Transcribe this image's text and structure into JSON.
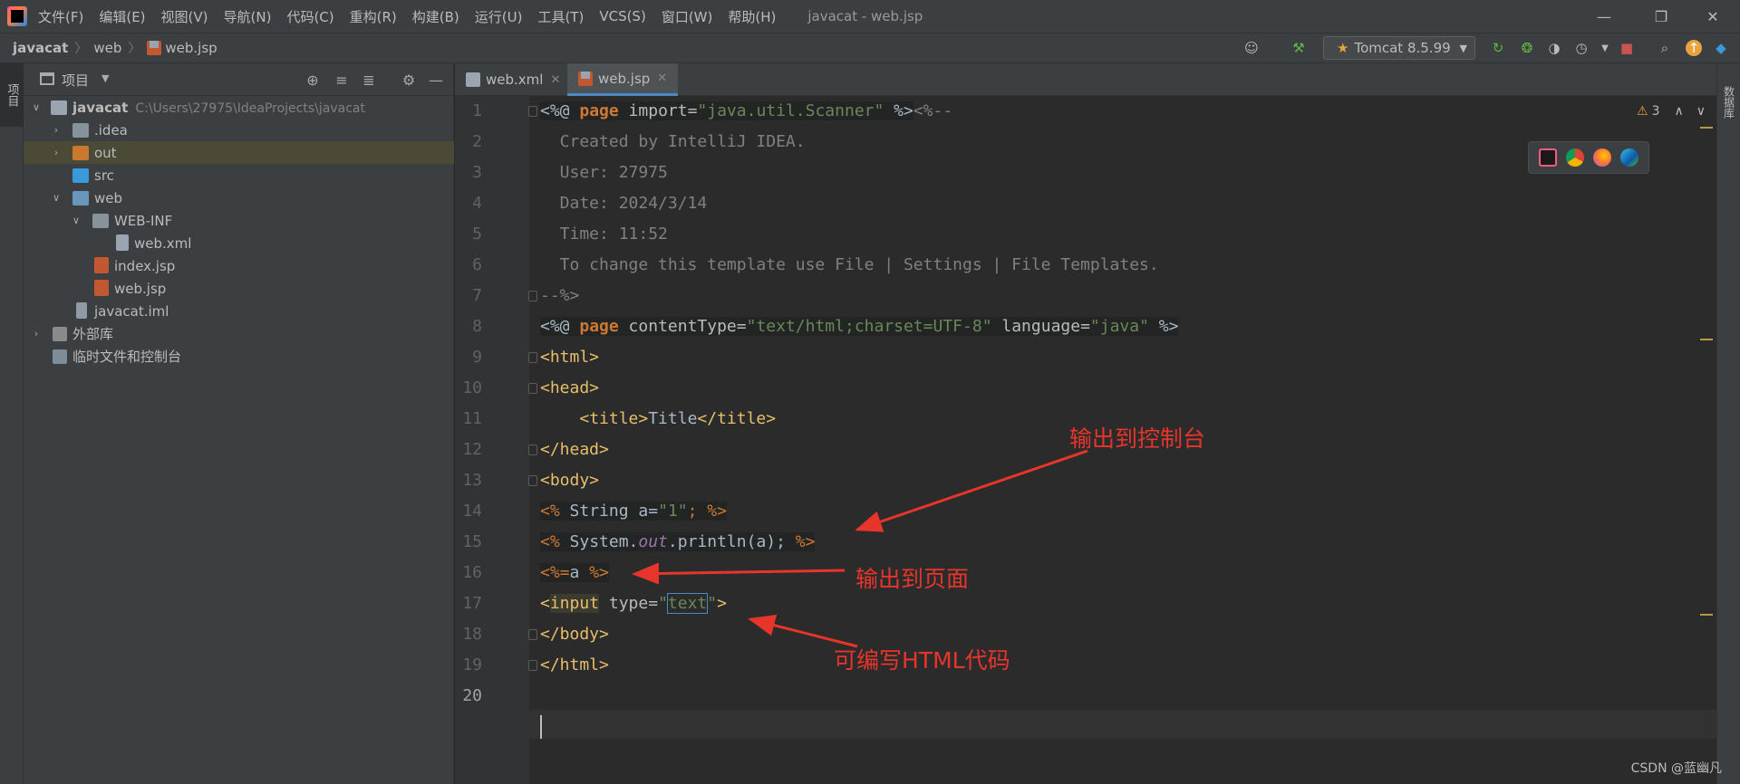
{
  "menu": {
    "items": [
      "文件(F)",
      "编辑(E)",
      "视图(V)",
      "导航(N)",
      "代码(C)",
      "重构(R)",
      "构建(B)",
      "运行(U)",
      "工具(T)",
      "VCS(S)",
      "窗口(W)",
      "帮助(H)"
    ],
    "window_title": "javacat - web.jsp"
  },
  "nav": {
    "crumb_project": "javacat",
    "crumb_folder": "web",
    "crumb_file": "web.jsp",
    "run_config": "Tomcat 8.5.99"
  },
  "side_tabs": {
    "left": "项目",
    "right": "数据库"
  },
  "project": {
    "header": "项目",
    "tree": {
      "root": "javacat",
      "root_path": "C:\\Users\\27975\\IdeaProjects\\javacat",
      "idea": ".idea",
      "out": "out",
      "src": "src",
      "web": "web",
      "webinf": "WEB-INF",
      "webxml": "web.xml",
      "indexjsp": "index.jsp",
      "webjsp": "web.jsp",
      "iml": "javacat.iml",
      "libs": "外部库",
      "scratch": "临时文件和控制台"
    }
  },
  "tabs": [
    "web.xml",
    "web.jsp"
  ],
  "editor": {
    "warnings": "3",
    "line_numbers": [
      "1",
      "2",
      "3",
      "4",
      "5",
      "6",
      "7",
      "8",
      "9",
      "10",
      "11",
      "12",
      "13",
      "14",
      "15",
      "16",
      "17",
      "18",
      "19",
      "20"
    ],
    "lines": {
      "l1_a": "<%@",
      "l1_b": "page",
      "l1_c": " import=",
      "l1_d": "\"java.util.Scanner\"",
      "l1_e": " %>",
      "l1_f": "<%--",
      "l2": "  Created by IntelliJ IDEA.",
      "l3": "  User: 27975",
      "l4": "  Date: 2024/3/14",
      "l5": "  Time: 11:52",
      "l6": "  To change this template use File | Settings | File Templates.",
      "l7": "--%>",
      "l8_a": "<%@",
      "l8_b": "page",
      "l8_c": " contentType=",
      "l8_d": "\"text/html;charset=UTF-8\"",
      "l8_e": " language=",
      "l8_f": "\"java\"",
      "l8_g": " %>",
      "l9": "<html>",
      "l10": "<head>",
      "l11_a": "<title>",
      "l11_b": "Title",
      "l11_c": "</title>",
      "l12": "</head>",
      "l13": "<body>",
      "l14_a": "<%",
      "l14_b": " String a=",
      "l14_c": "\"1\"",
      "l14_d": "; ",
      "l14_e": "%>",
      "l15_a": "<%",
      "l15_b": " System.",
      "l15_c": "out",
      "l15_d": ".println(a); ",
      "l15_e": "%>",
      "l16_a": "<%=",
      "l16_b": "a ",
      "l16_c": "%>",
      "l17_a": "<",
      "l17_b": "input",
      "l17_c": " type=",
      "l17_d": "\"",
      "l17_e": "text",
      "l17_f": "\"",
      "l17_g": ">",
      "l18": "</body>",
      "l19": "</html>"
    }
  },
  "annotations": {
    "console": "输出到控制台",
    "page": "输出到页面",
    "html": "可编写HTML代码"
  },
  "watermark": "CSDN @蓝幽凡",
  "colors": {
    "annotation": "#e8352b",
    "accent": "#4a88c7"
  }
}
